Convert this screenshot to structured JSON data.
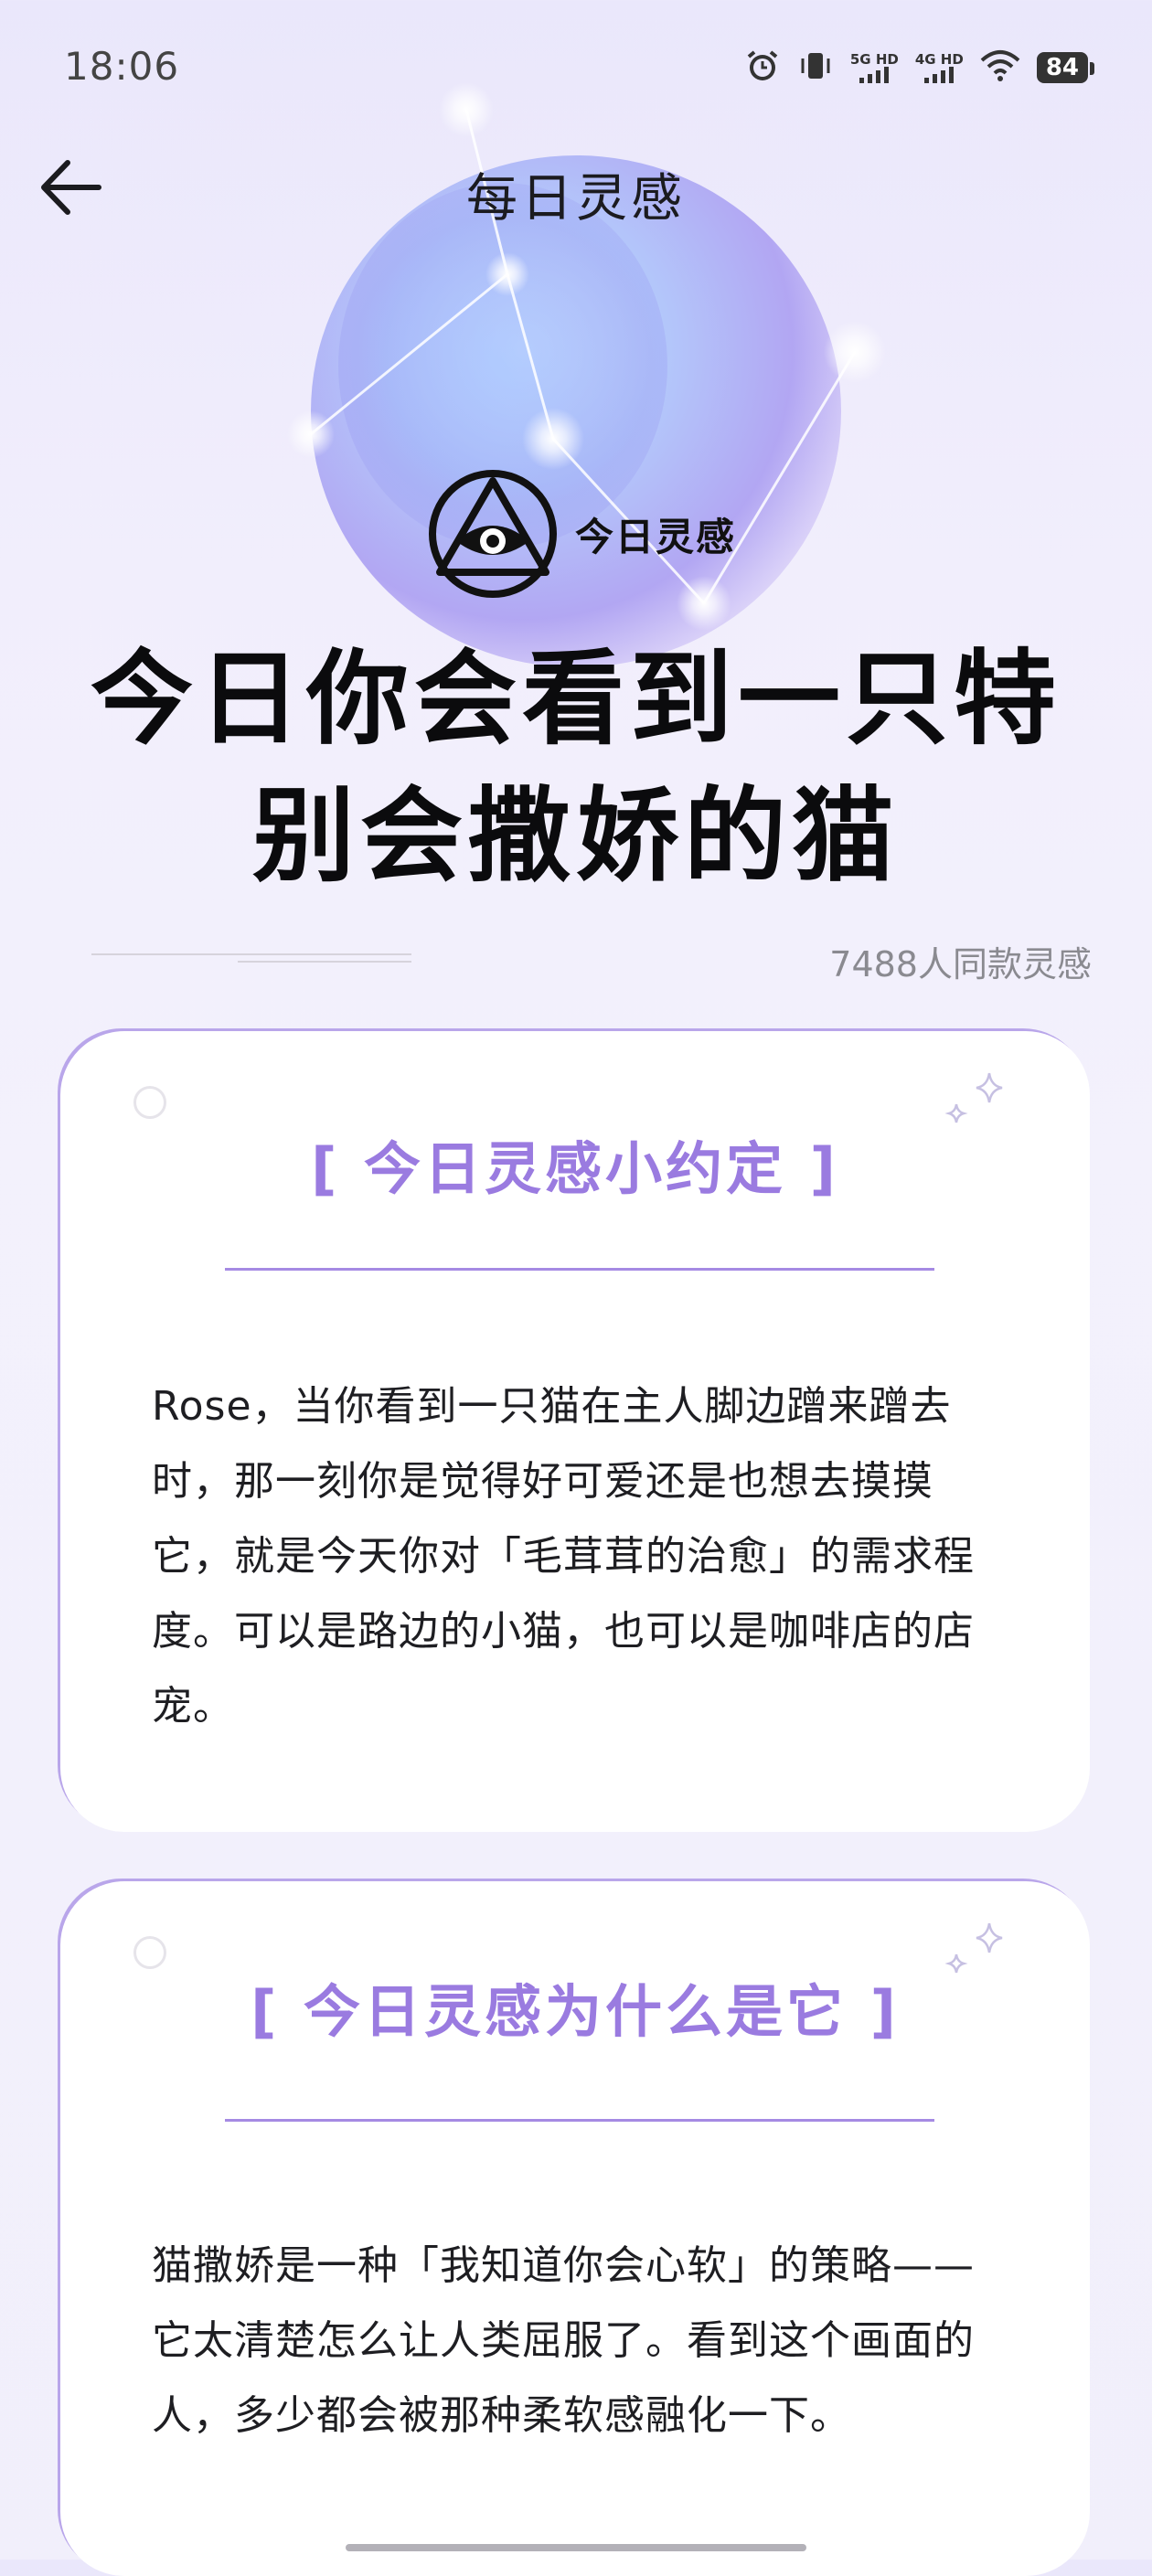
{
  "status_bar": {
    "time": "18:06",
    "sim1_label": "5G HD",
    "sim2_label": "4G HD",
    "battery": "84",
    "icons": [
      "alarm-icon",
      "vibrate-icon",
      "signal-icon",
      "signal-icon",
      "wifi-icon",
      "battery-icon"
    ]
  },
  "header": {
    "back_icon": "arrow-left-icon",
    "title": "每日灵感"
  },
  "brand": {
    "logo_icon": "eye-triangle-icon",
    "name": "今日灵感"
  },
  "headline": "今日你会看到一只特别会撒娇的猫",
  "participants_text": "7488人同款灵感",
  "cards": [
    {
      "title": "[ 今日灵感小约定 ]",
      "body": "Rose，当你看到一只猫在主人脚边蹭来蹭去时，那一刻你是觉得好可爱还是也想去摸摸它，就是今天你对「毛茸茸的治愈」的需求程度。可以是路边的小猫，也可以是咖啡店的店宠。"
    },
    {
      "title": "[ 今日灵感为什么是它 ]",
      "body": "猫撒娇是一种「我知道你会心软」的策略——它太清楚怎么让人类屈服了。看到这个画面的人，多少都会被那种柔软感融化一下。"
    }
  ],
  "colors": {
    "accent": "#9a7be0",
    "rule": "#a58ae3",
    "background": "#f1effb"
  }
}
